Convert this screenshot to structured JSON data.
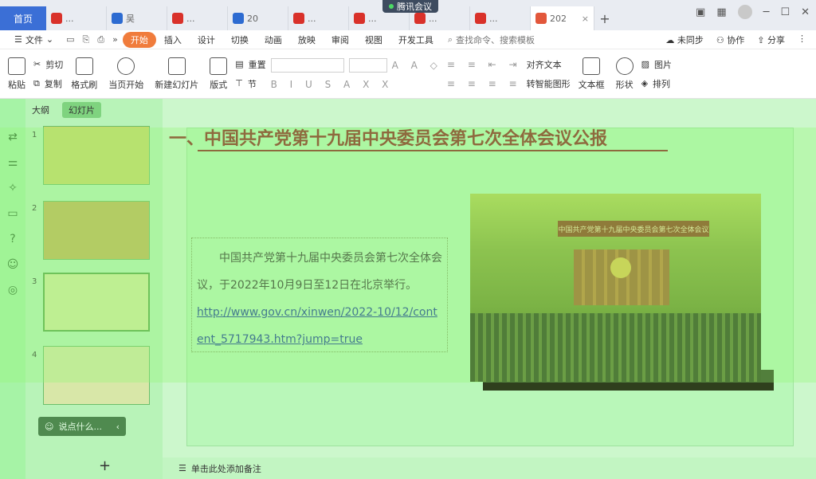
{
  "tabs": {
    "home": "首页",
    "items": [
      "...",
      "吴",
      "...",
      "20",
      "...",
      "...",
      "...",
      "..."
    ],
    "active": "202",
    "meeting": "腾讯会议"
  },
  "menu": {
    "file": "文件",
    "items": [
      "开始",
      "插入",
      "设计",
      "切换",
      "动画",
      "放映",
      "审阅",
      "视图",
      "开发工具"
    ],
    "search_placeholder": "查找命令、搜索模板",
    "right": [
      "未同步",
      "协作",
      "分享"
    ]
  },
  "ribbon": {
    "paste": "粘贴",
    "cut": "剪切",
    "copy": "复制",
    "format_painter": "格式刷",
    "play_from_current": "当页开始",
    "new_slide": "新建幻灯片",
    "layout": "版式",
    "section": "节",
    "reset": "重置",
    "align_text": "对齐文本",
    "convert_smartart": "转智能图形",
    "textbox": "文本框",
    "shape": "形状",
    "image": "图片",
    "arrange": "排列"
  },
  "sidebar": {
    "tabs": [
      "大纲",
      "幻灯片"
    ],
    "slide_numbers": [
      "1",
      "2",
      "3",
      "4"
    ],
    "say_something": "说点什么...",
    "add_slide": "+"
  },
  "slide": {
    "heading": "一、中国共产党第十九届中央委员会第七次全体会议公报",
    "body": "中国共产党第十九届中央委员会第七次全体会议，于2022年10月9日至12日在北京举行。",
    "link": "http://www.gov.cn/xinwen/2022-10/12/content_5717943.htm?jump=true",
    "photo_banner": "中国共产党第十九届中央委员会第七次全体会议"
  },
  "notes": {
    "placeholder": "单击此处添加备注"
  },
  "colors": {
    "accent_orange": "#f07c3c",
    "home_blue": "#3b6fd6",
    "heading_red": "#8b1f1f",
    "overlay_green": "#a6f3a6"
  }
}
